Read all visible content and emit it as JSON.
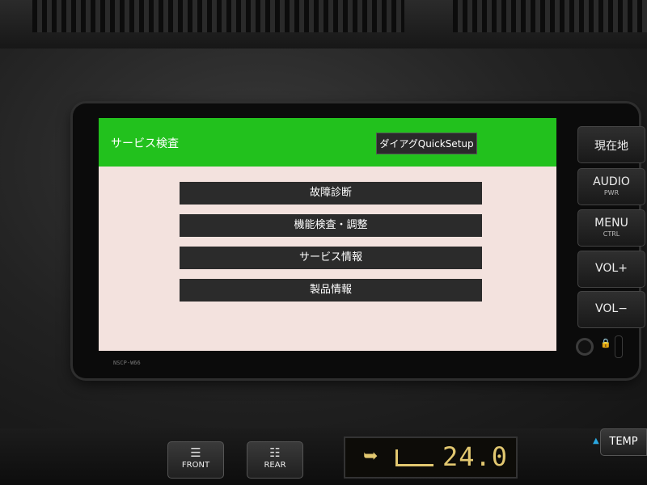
{
  "screen": {
    "title": "サービス検査",
    "header_button": "ダイアグQuickSetup",
    "menu_items": [
      {
        "label": "故障診断"
      },
      {
        "label": "機能検査・調整"
      },
      {
        "label": "サービス情報"
      },
      {
        "label": "製品情報"
      }
    ],
    "colors": {
      "header": "#22c11d",
      "background": "#f3e2de",
      "buttons": "#2b2b2b"
    }
  },
  "bezel_label": "NSCP-W66",
  "hardware_buttons": [
    {
      "main": "現在地",
      "sub": ""
    },
    {
      "main": "AUDIO",
      "sub": "PWR"
    },
    {
      "main": "MENU",
      "sub": "CTRL"
    },
    {
      "main": "VOL+",
      "sub": ""
    },
    {
      "main": "VOL−",
      "sub": ""
    }
  ],
  "climate": {
    "front_label": "FRONT",
    "rear_label": "REAR",
    "temperature": "24.0",
    "temp_button": "TEMP"
  }
}
